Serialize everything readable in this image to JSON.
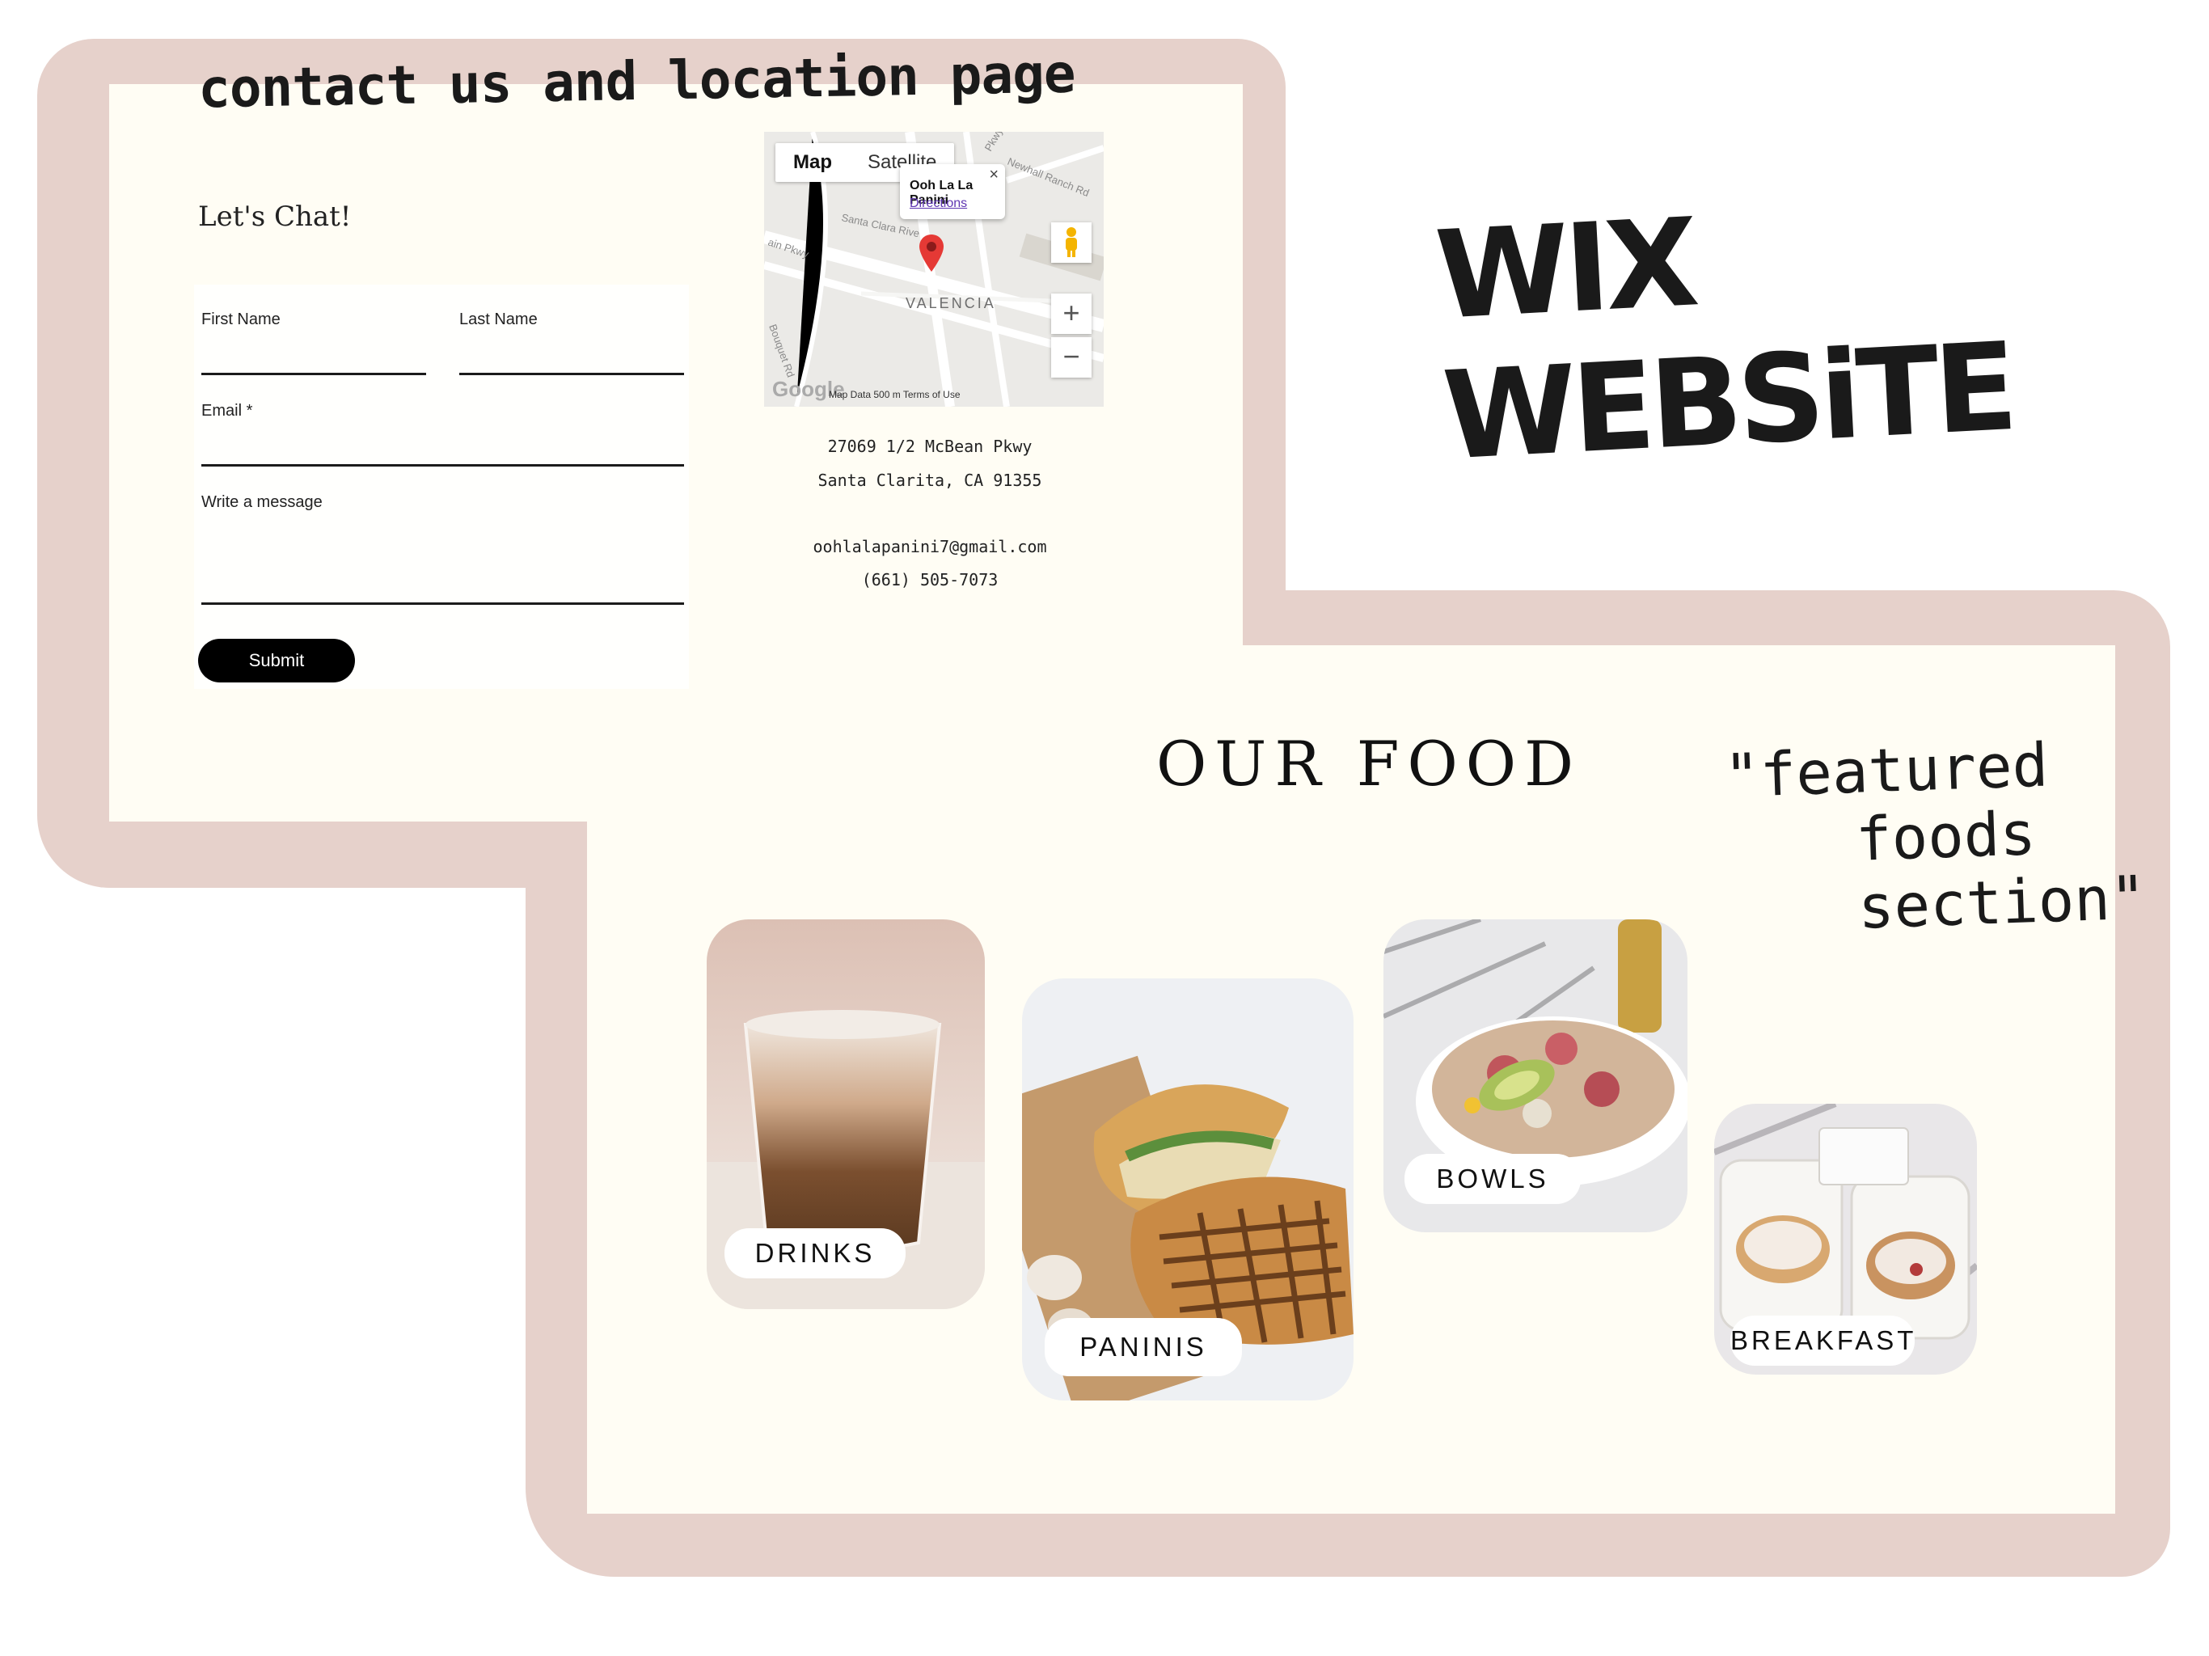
{
  "annotations": {
    "contact_page": "contact us and location page",
    "wix_website": "WIX WEBSiTE",
    "featured_line1": "\"featured",
    "featured_line2": "foods section\""
  },
  "contact_form": {
    "title": "Let's Chat!",
    "first_name_label": "First Name",
    "last_name_label": "Last Name",
    "email_label": "Email *",
    "message_label": "Write a message",
    "submit_label": "Submit"
  },
  "map": {
    "tab_map": "Map",
    "tab_satellite": "Satellite",
    "popup_name": "Ooh La La Panini",
    "popup_directions": "Directions",
    "popup_close": "×",
    "city_label": "VALENCIA",
    "zoom_in": "+",
    "zoom_out": "−",
    "google": "Google",
    "footer_text": "Map Data   500 m          Terms of Use",
    "street_labels": [
      "Newhall Ranch Rd",
      "Santa Clara Rive",
      "ain Pkwy",
      "Pkwy",
      "Bouquet Rd"
    ]
  },
  "contact_info": {
    "address_line1": "27069 1/2 McBean Pkwy",
    "address_line2": "Santa Clarita, CA 91355",
    "email": "oohlalapanini7@gmail.com",
    "phone": "(661) 505-7073"
  },
  "food_section": {
    "title": "OUR FOOD",
    "cards": [
      {
        "label": "DRINKS"
      },
      {
        "label": "PANINIS"
      },
      {
        "label": "BOWLS"
      },
      {
        "label": "BREAKFAST"
      }
    ]
  },
  "colors": {
    "frame": "#e6d1cb",
    "panel": "#fffdf4",
    "button": "#000000"
  }
}
